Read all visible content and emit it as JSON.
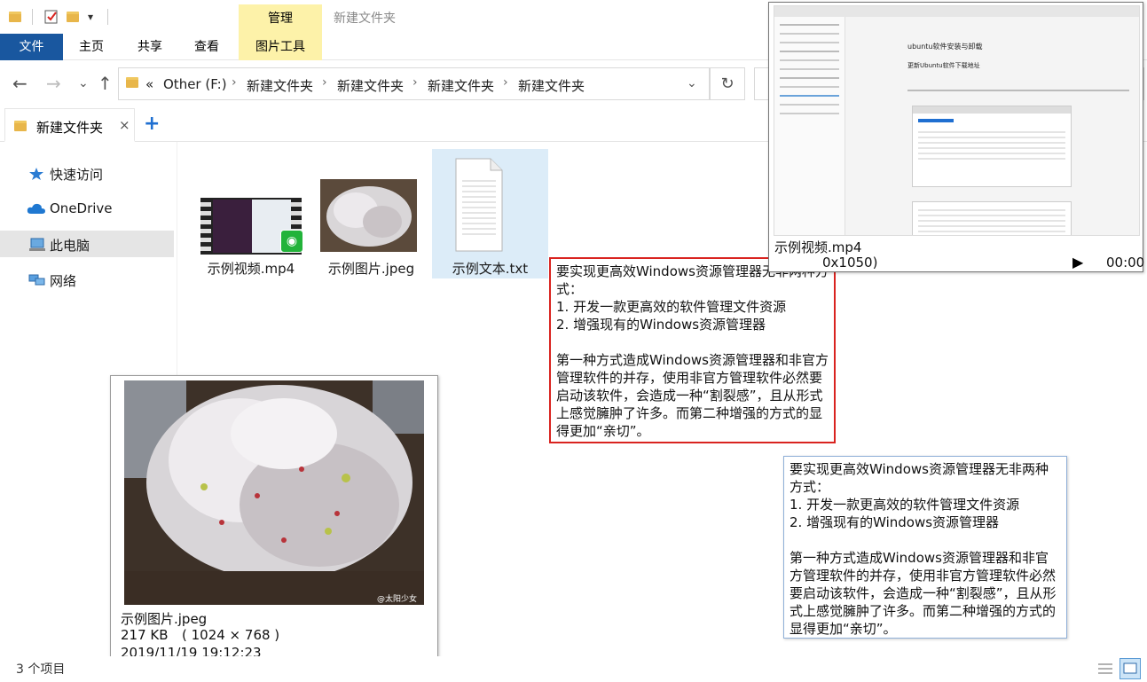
{
  "window": {
    "title": "新建文件夹",
    "context_tab": "管理"
  },
  "ribbon": {
    "tabs": [
      "文件",
      "主页",
      "共享",
      "查看",
      "图片工具"
    ]
  },
  "address": {
    "prefix": "«",
    "crumbs": [
      "Other (F:)",
      "新建文件夹",
      "新建文件夹",
      "新建文件夹",
      "新建文件夹"
    ]
  },
  "tabstrip": {
    "tab_label": "新建文件夹",
    "close": "×",
    "add": "+"
  },
  "sidebar": {
    "items": [
      {
        "label": "快速访问",
        "icon": "star-icon"
      },
      {
        "label": "OneDrive",
        "icon": "cloud-icon"
      },
      {
        "label": "此电脑",
        "icon": "computer-icon"
      },
      {
        "label": "网络",
        "icon": "network-icon"
      }
    ]
  },
  "files": [
    {
      "name": "示例视频.mp4",
      "icon": "video-thumbnail"
    },
    {
      "name": "示例图片.jpeg",
      "icon": "image-thumbnail"
    },
    {
      "name": "示例文本.txt",
      "icon": "text-file-icon"
    }
  ],
  "text_tip": {
    "content": "要实现更高效Windows资源管理器无非两种方式：\n1. 开发一款更高效的软件管理文件资源\n2. 增强现有的Windows资源管理器\n\n第一种方式造成Windows资源管理器和非官方管理软件的并存，使用非官方管理软件必然要启动该软件，会造成一种“割裂感”，且从形式上感觉臃肿了许多。而第二种增强的方式的显得更加“亲切”。"
  },
  "image_preview": {
    "name": "示例图片.jpeg",
    "size": "217 KB",
    "dimensions": "( 1024 × 768 )",
    "date": "2019/11/19 19:12:23",
    "watermark": "@太阳少女"
  },
  "video_preview": {
    "name": "示例视频.mp4",
    "resolution_partial": "0x1050)",
    "time": "00:00",
    "play": "▶",
    "doc_title": "ubuntu软件安装与卸载",
    "doc_heading": "更新Ubuntu软件下载地址"
  },
  "status": {
    "count": "3 个项目"
  }
}
